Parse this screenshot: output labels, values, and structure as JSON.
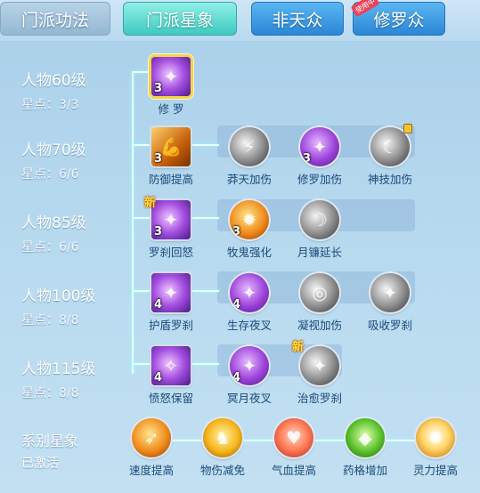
{
  "tabs": [
    {
      "label": "门派功法",
      "style": "grey"
    },
    {
      "label": "门派星象",
      "style": "active"
    },
    {
      "label": "非天众",
      "style": "blue"
    },
    {
      "label": "修罗众",
      "style": "blue",
      "badge": "使用中"
    }
  ],
  "rows": [
    {
      "level": "人物60级",
      "stars": "星点：3/3"
    },
    {
      "level": "人物70级",
      "stars": "星点：6/6"
    },
    {
      "level": "人物85级",
      "stars": "星点：6/6"
    },
    {
      "level": "人物100级",
      "stars": "星点：8/8"
    },
    {
      "level": "人物115级",
      "stars": "星点：8/8"
    }
  ],
  "nodes": {
    "r1": [
      {
        "label": "修 罗",
        "num": "3"
      }
    ],
    "r2": [
      {
        "label": "防御提高",
        "num": "3"
      },
      {
        "label": "莽天加伤",
        "num": ""
      },
      {
        "label": "修罗加伤",
        "num": "3"
      },
      {
        "label": "神技加伤",
        "num": ""
      }
    ],
    "r3": [
      {
        "label": "罗刹回怒",
        "num": "3",
        "new": "新"
      },
      {
        "label": "牧鬼强化",
        "num": "3"
      },
      {
        "label": "月镰延长",
        "num": ""
      }
    ],
    "r4": [
      {
        "label": "护盾罗刹",
        "num": "4"
      },
      {
        "label": "生存夜叉",
        "num": "4"
      },
      {
        "label": "凝视加伤",
        "num": ""
      },
      {
        "label": "吸收罗刹",
        "num": ""
      }
    ],
    "r5": [
      {
        "label": "愤怒保留",
        "num": "4"
      },
      {
        "label": "冥月夜叉",
        "num": "4"
      },
      {
        "label": "治愈罗刹",
        "num": "",
        "new": "新"
      }
    ]
  },
  "series": {
    "title": "系别星象",
    "status": "已激活",
    "items": [
      {
        "label": "速度提高"
      },
      {
        "label": "物伤减免"
      },
      {
        "label": "气血提高"
      },
      {
        "label": "药格增加"
      },
      {
        "label": "灵力提高"
      }
    ]
  }
}
